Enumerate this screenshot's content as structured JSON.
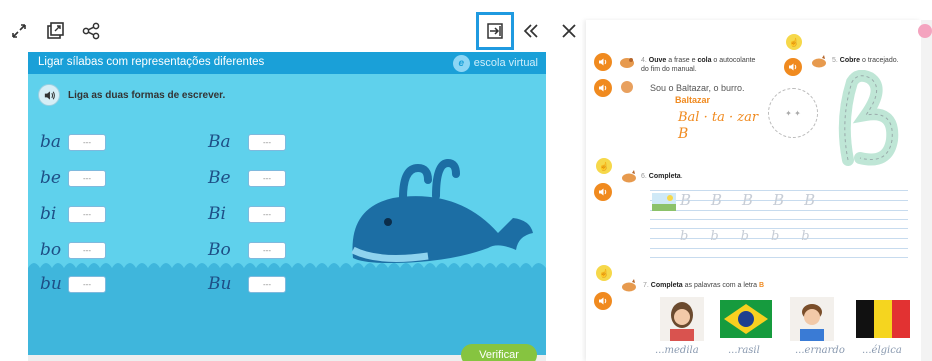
{
  "toolbar": {
    "expand_icon": "expand-icon",
    "open_icon": "open-external-icon",
    "share_icon": "share-icon",
    "exit_icon": "exit-to-right-icon",
    "collapse_icon": "double-chevron-left-icon",
    "close_icon": "close-icon",
    "highlight_color": "#1f9ae0"
  },
  "activity": {
    "title": "Ligar sílabas com representações diferentes",
    "brand": "escola virtual",
    "instruction": "Liga as duas formas de escrever.",
    "left_syllables": [
      "ba",
      "be",
      "bi",
      "bo",
      "bu"
    ],
    "right_syllables": [
      "Ba",
      "Be",
      "Bi",
      "Bo",
      "Bu"
    ],
    "slot_placeholder": "---",
    "verify_label": "Verificar",
    "colors": {
      "header": "#1aa0d8",
      "background": "#5fd1ec",
      "verify": "#86c440",
      "whale": "#1c6ea4"
    }
  },
  "book": {
    "ex4": {
      "number": "4.",
      "text_a": "Ouve",
      "text_b": " a frase e ",
      "text_c": "cola",
      "text_d": " o autocolante",
      "text_e": "do fim do manual."
    },
    "ex5": {
      "number": "5.",
      "bold": "Cobre",
      "rest": " o tracejado."
    },
    "sentence_1": "Sou o Baltazar, o burro.",
    "sentence_2": "Baltazar",
    "script_word": "Bal · ta · zar",
    "script_letter": "B",
    "ex6": {
      "number": "6.",
      "bold": "Completa",
      "rest": "."
    },
    "ex7": {
      "number": "7.",
      "bold": "Completa",
      "rest": " as palavras com a letra"
    },
    "words": [
      "...medila",
      "...rasil",
      "...ernardo",
      "...élgica"
    ],
    "colors": {
      "audio": "#f08a1f",
      "hand": "#f6d84a",
      "accent": "#f08a1f"
    }
  }
}
